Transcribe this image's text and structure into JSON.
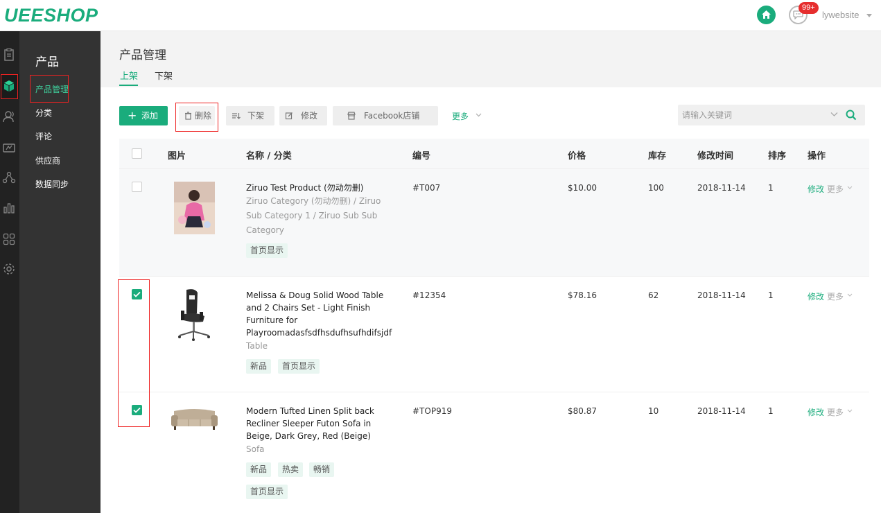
{
  "header": {
    "logo": "UEESHOP",
    "badge": "99+",
    "user": "lywebsite",
    "icons": [
      "home-icon",
      "message-icon"
    ]
  },
  "rail": {
    "icons": [
      "orders-icon",
      "product-box-icon",
      "users-icon",
      "marketing-icon",
      "share-icon",
      "stats-icon",
      "apps-icon",
      "settings-icon"
    ]
  },
  "submenu": {
    "title": "产品",
    "items": [
      {
        "label": "产品管理"
      },
      {
        "label": "分类"
      },
      {
        "label": "评论"
      },
      {
        "label": "供应商"
      },
      {
        "label": "数据同步"
      }
    ]
  },
  "page": {
    "title": "产品管理",
    "tabs": [
      {
        "label": "上架"
      },
      {
        "label": "下架"
      }
    ]
  },
  "toolbar": {
    "add_label": "添加",
    "delete_label": "删除",
    "unlist_label": "下架",
    "edit_label": "修改",
    "facebook_label": "Facebook店铺",
    "more_label": "更多",
    "search_placeholder": "请输入关键词"
  },
  "table": {
    "columns": [
      "图片",
      "名称 / 分类",
      "编号",
      "价格",
      "库存",
      "修改时间",
      "排序",
      "操作"
    ],
    "edit_label": "修改",
    "more_label": "更多",
    "rows": [
      {
        "checked": false,
        "name": "Ziruo Test Product (勿动勿删)",
        "category": "Ziruo Category (勿动勿删) / Ziruo Sub Category 1 / Ziruo Sub Sub Category",
        "tags": [
          "首页显示"
        ],
        "sku": "#T007",
        "price": "$10.00",
        "stock": "100",
        "date": "2018-11-14",
        "order": "1"
      },
      {
        "checked": true,
        "name": "Melissa & Doug Solid Wood Table and 2 Chairs Set - Light Finish Furniture for Playroomadasfsdfhsdufhsufhdifsjdf",
        "category": "Table",
        "tags": [
          "新品",
          "首页显示"
        ],
        "sku": "#12354",
        "price": "$78.16",
        "stock": "62",
        "date": "2018-11-14",
        "order": "1"
      },
      {
        "checked": true,
        "name": "Modern Tufted Linen Split back Recliner Sleeper Futon Sofa in Beige, Dark Grey, Red (Beige)",
        "category": "Sofa",
        "tags": [
          "新品",
          "热卖",
          "畅销",
          "首页显示"
        ],
        "sku": "#TOP919",
        "price": "$80.87",
        "stock": "10",
        "date": "2018-11-14",
        "order": "1"
      }
    ]
  },
  "colors": {
    "accent": "#1aac7c",
    "highlight": "#e22222",
    "sidebar": "#333333",
    "rail": "#222222"
  }
}
